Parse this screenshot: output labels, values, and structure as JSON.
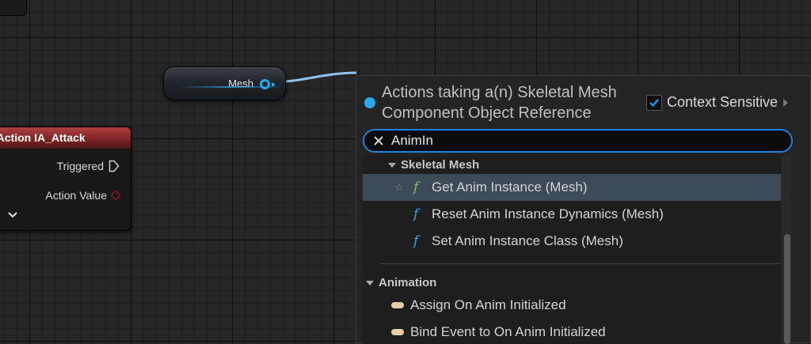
{
  "graph": {
    "mesh_node": {
      "label": "Mesh"
    },
    "action_node": {
      "title": "tAction IA_Attack",
      "pins": [
        {
          "label": "Triggered",
          "type": "exec"
        },
        {
          "label": "Action Value",
          "type": "value"
        }
      ]
    }
  },
  "menu": {
    "title": "Actions taking a(n) Skeletal Mesh Component Object Reference",
    "context_sensitive": {
      "label": "Context Sensitive",
      "checked": true
    },
    "search": {
      "value": "AnimIn"
    },
    "categories": [
      {
        "name": "Skeletal Mesh",
        "items": [
          {
            "label": "Get Anim Instance (Mesh)",
            "icon": "function-icon",
            "selected": true
          },
          {
            "label": "Reset Anim Instance Dynamics (Mesh)",
            "icon": "function-icon"
          },
          {
            "label": "Set Anim Instance Class (Mesh)",
            "icon": "function-icon"
          }
        ]
      },
      {
        "name": "Animation",
        "items": [
          {
            "label": "Assign On Anim Initialized",
            "icon": "event-icon"
          },
          {
            "label": "Bind Event to On Anim Initialized",
            "icon": "event-icon"
          }
        ]
      }
    ]
  },
  "colors": {
    "object_pin": "#2ba8ef",
    "search_focus": "#1f7fd9",
    "selected_row": "#3d4a57",
    "action_header": "#8a2a2a"
  }
}
